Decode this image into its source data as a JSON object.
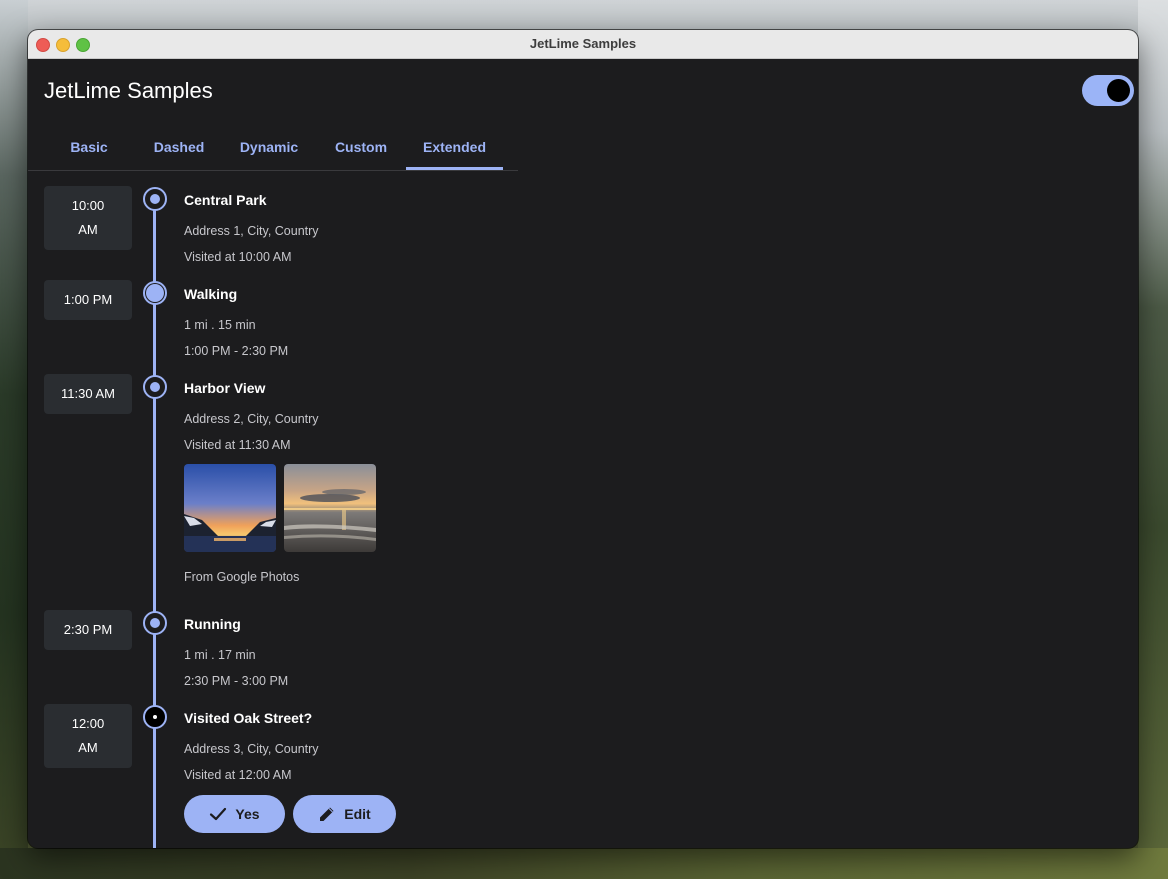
{
  "window": {
    "title": "JetLime Samples"
  },
  "app": {
    "title": "JetLime Samples",
    "theme_toggle": {
      "state": "on",
      "icon": "toggle-switch-icon"
    }
  },
  "tabs": [
    {
      "label": "Basic",
      "active": false
    },
    {
      "label": "Dashed",
      "active": false
    },
    {
      "label": "Dynamic",
      "active": false
    },
    {
      "label": "Custom",
      "active": false
    },
    {
      "label": "Extended",
      "active": true
    }
  ],
  "timeline": {
    "items": [
      {
        "time_line1": "10:00",
        "time_line2": "AM",
        "title": "Central Park",
        "detail1": "Address 1, City, Country",
        "detail2": "Visited at 10:00 AM",
        "point_style": "ring"
      },
      {
        "time_line1": "1:00 PM",
        "time_line2": "",
        "title": "Walking",
        "detail1": "1 mi . 15 min",
        "detail2": "1:00 PM - 2:30 PM",
        "point_style": "filled"
      },
      {
        "time_line1": "11:30 AM",
        "time_line2": "",
        "title": "Harbor View",
        "detail1": "Address 2, City, Country",
        "detail2": "Visited at 11:30 AM",
        "point_style": "ring",
        "photos_caption": "From Google Photos"
      },
      {
        "time_line1": "2:30 PM",
        "time_line2": "",
        "title": "Running",
        "detail1": "1 mi . 17 min",
        "detail2": "2:30 PM - 3:00 PM",
        "point_style": "ring"
      },
      {
        "time_line1": "12:00",
        "time_line2": "AM",
        "title": "Visited Oak Street?",
        "detail1": "Address 3, City, Country",
        "detail2": "Visited at 12:00 AM",
        "point_style": "dark"
      }
    ]
  },
  "actions": {
    "yes_label": "Yes",
    "yes_icon": "check-icon",
    "edit_label": "Edit",
    "edit_icon": "pencil-icon"
  },
  "colors": {
    "accent": "#9db3f5",
    "background": "#1c1c1e",
    "time_box": "#2a2d31",
    "text_primary": "#ffffff",
    "text_secondary": "#c7c7cc"
  }
}
